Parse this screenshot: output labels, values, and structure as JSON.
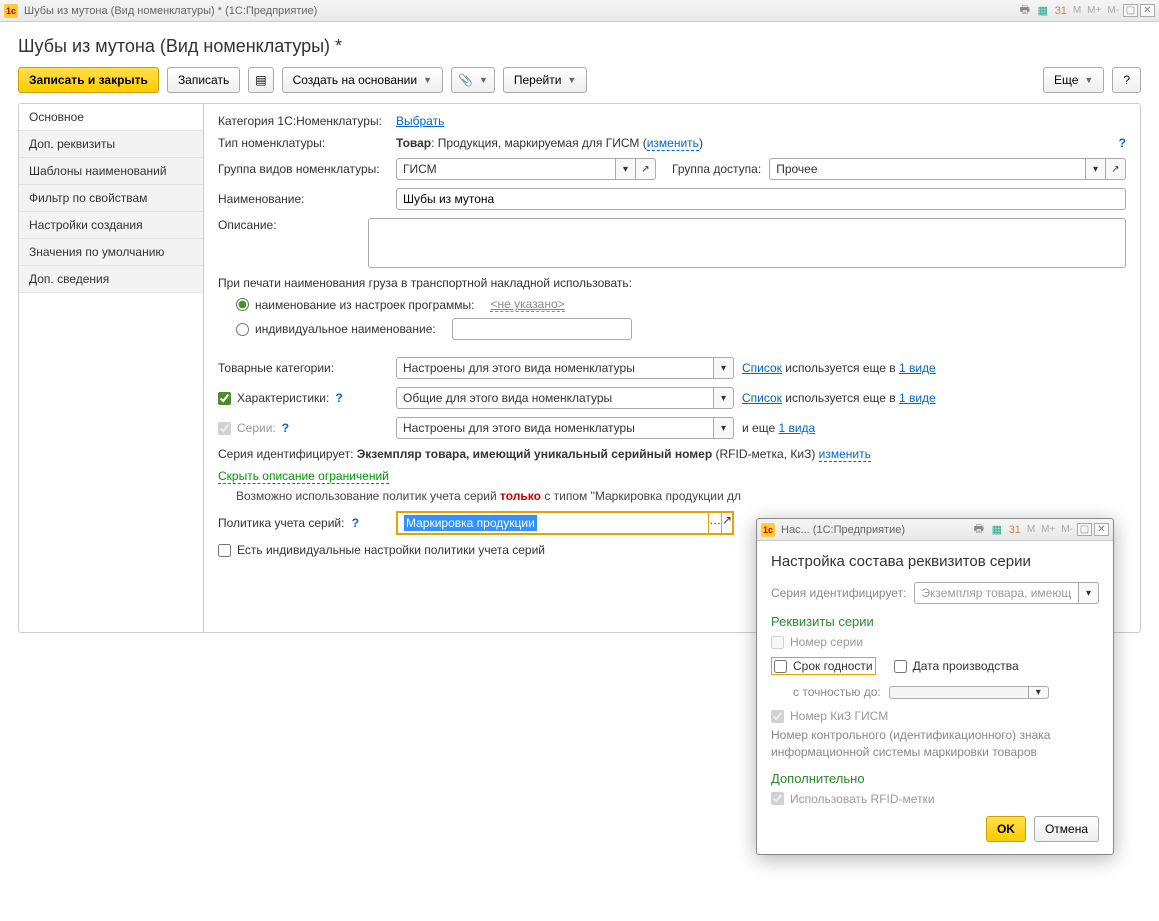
{
  "titlebar": {
    "title": "Шубы из мутона (Вид номенклатуры) *  (1С:Предприятие)"
  },
  "header": {
    "title": "Шубы из мутона (Вид номенклатуры) *"
  },
  "toolbar": {
    "save_close": "Записать и закрыть",
    "save": "Записать",
    "create_based": "Создать на основании",
    "go": "Перейти",
    "more": "Еще",
    "help": "?"
  },
  "sidebar": {
    "items": [
      {
        "label": "Основное"
      },
      {
        "label": "Доп. реквизиты"
      },
      {
        "label": "Шаблоны наименований"
      },
      {
        "label": "Фильтр по свойствам"
      },
      {
        "label": "Настройки создания"
      },
      {
        "label": "Значения по умолчанию"
      },
      {
        "label": "Доп. сведения"
      }
    ]
  },
  "form": {
    "category_label": "Категория 1С:Номенклатуры:",
    "category_choose": "Выбрать",
    "type_label": "Тип номенклатуры:",
    "type_value_bold": "Товар",
    "type_value_rest": ": Продукция, маркируемая для ГИСМ (",
    "type_change": "изменить",
    "type_close": ")",
    "group_label": "Группа видов номенклатуры:",
    "group_value": "ГИСМ",
    "access_label": "Группа доступа:",
    "access_value": "Прочее",
    "name_label": "Наименование:",
    "name_value": "Шубы из мутона",
    "desc_label": "Описание:",
    "desc_value": "",
    "print_caption": "При печати наименования груза в транспортной накладной использовать:",
    "radio1": "наименование из настроек программы:",
    "radio1_hint": "<не указано>",
    "radio2": "индивидуальное наименование:",
    "cat_label": "Товарные категории:",
    "cat_value": "Настроены для этого вида номенклатуры",
    "list_link": "Список",
    "used_text": " используется еще в ",
    "used_link": "1 виде",
    "chars_label": "Характеристики:",
    "chars_value": "Общие для этого вида номенклатуры",
    "series_label": "Серии:",
    "series_value": "Настроены для этого вида номенклатуры",
    "and_more": "и еще ",
    "one_kind": "1 вида",
    "series_ident_label": "Серия идентифицирует:",
    "series_ident_bold": "Экземпляр товара, имеющий уникальный серийный номер",
    "series_ident_rest": " (RFID-метка, КиЗ) ",
    "series_change": "изменить",
    "hide_desc": "Скрыть описание ограничений",
    "restrict_text1": "Возможно использование политик учета серий ",
    "restrict_bold": "только",
    "restrict_text2": " с типом \"Маркировка продукции дл",
    "policy_label": "Политика учета серий:",
    "policy_value": "Маркировка продукции",
    "indiv_check": "Есть индивидуальные настройки политики учета серий"
  },
  "dialog": {
    "titlebar": "Нас...  (1С:Предприятие)",
    "title": "Настройка состава реквизитов серии",
    "ident_label": "Серия идентифицирует:",
    "ident_value": "Экземпляр товара, имеющ",
    "section_req": "Реквизиты серии",
    "chk_number": "Номер серии",
    "chk_expiry": "Срок годности",
    "chk_prod_date": "Дата производства",
    "precision_label": "с точностью до:",
    "precision_value": "",
    "chk_kiz": "Номер КиЗ ГИСМ",
    "hint": "Номер контрольного (идентификационного) знака информационной системы маркировки товаров",
    "section_add": "Дополнительно",
    "chk_rfid": "Использовать RFID-метки",
    "ok": "OK",
    "cancel": "Отмена"
  }
}
